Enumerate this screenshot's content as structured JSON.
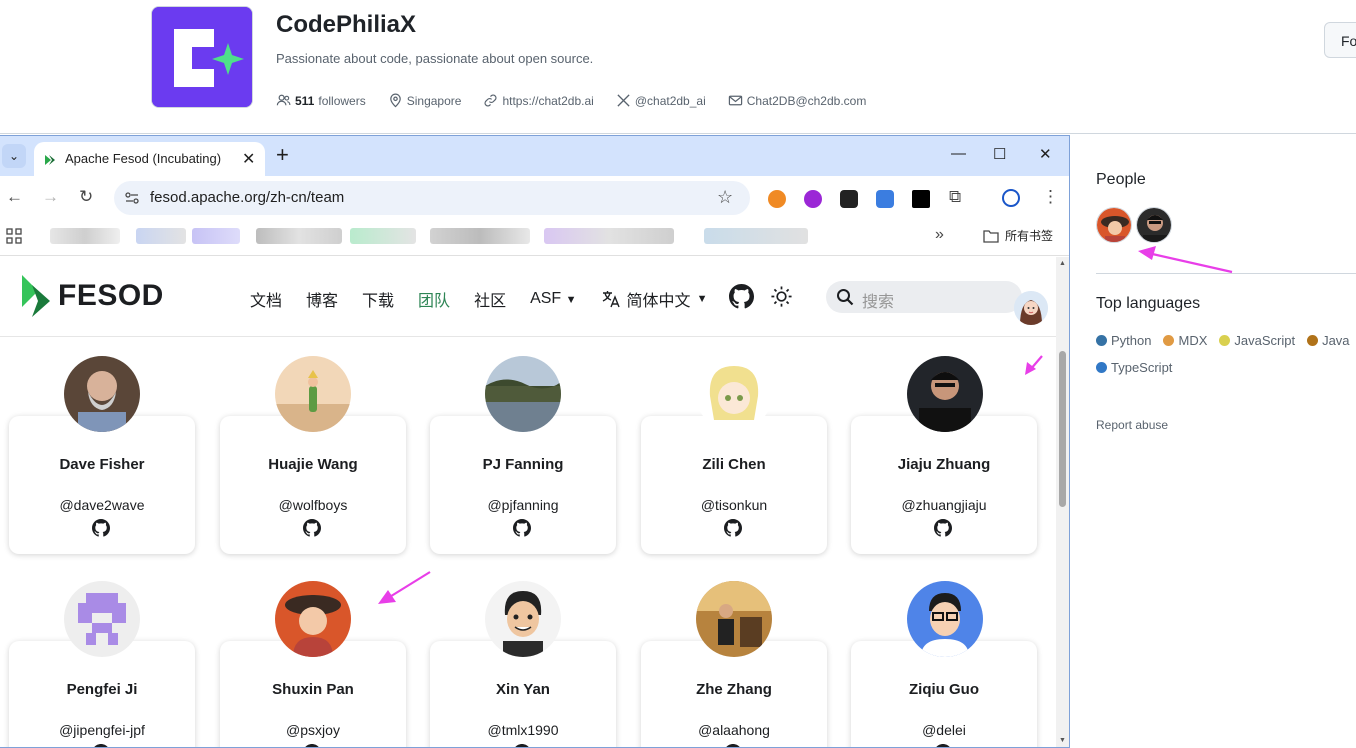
{
  "org": {
    "name": "CodePhiliaX",
    "description": "Passionate about code, passionate about open source.",
    "followers_count": "511",
    "followers_label": "followers",
    "location": "Singapore",
    "website": "https://chat2db.ai",
    "twitter": "@chat2db_ai",
    "email": "Chat2DB@ch2db.com",
    "follow_label": "Fo"
  },
  "sidebar": {
    "people_title": "People",
    "languages_title": "Top languages",
    "languages": [
      {
        "name": "Python",
        "color": "#3572A5"
      },
      {
        "name": "MDX",
        "color": "#e09a43"
      },
      {
        "name": "JavaScript",
        "color": "#d9d04f"
      },
      {
        "name": "Java",
        "color": "#b07219"
      },
      {
        "name": "TypeScript",
        "color": "#3178c6"
      }
    ],
    "report_label": "Report abuse"
  },
  "browser": {
    "tab_title": "Apache Fesod (Incubating)",
    "url": "fesod.apache.org/zh-cn/team",
    "all_bookmarks": "所有书签"
  },
  "site": {
    "brand": "FESOD",
    "menu": [
      {
        "label": "文档",
        "active": false
      },
      {
        "label": "博客",
        "active": false
      },
      {
        "label": "下载",
        "active": false
      },
      {
        "label": "团队",
        "active": true
      },
      {
        "label": "社区",
        "active": false
      },
      {
        "label": "ASF",
        "active": false
      }
    ],
    "language": "简体中文",
    "search_placeholder": "搜索",
    "team": [
      {
        "name": "Dave Fisher",
        "handle": "@dave2wave"
      },
      {
        "name": "Huajie Wang",
        "handle": "@wolfboys"
      },
      {
        "name": "PJ Fanning",
        "handle": "@pjfanning"
      },
      {
        "name": "Zili Chen",
        "handle": "@tisonkun"
      },
      {
        "name": "Jiaju Zhuang",
        "handle": "@zhuangjiaju"
      },
      {
        "name": "Pengfei Ji",
        "handle": "@jipengfei-jpf"
      },
      {
        "name": "Shuxin Pan",
        "handle": "@psxjoy"
      },
      {
        "name": "Xin Yan",
        "handle": "@tmlx1990"
      },
      {
        "name": "Zhe Zhang",
        "handle": "@alaahong"
      },
      {
        "name": "Ziqiu Guo",
        "handle": "@delei"
      }
    ]
  },
  "colors": {
    "accent_green": "#2e8555",
    "annotation_arrow": "#e83ee8",
    "tabstrip": "#d3e3fd"
  }
}
